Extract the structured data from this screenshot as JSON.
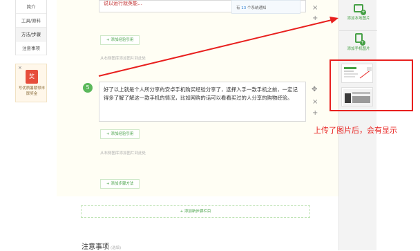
{
  "left_nav": {
    "items": [
      {
        "label": "简介",
        "active": false
      },
      {
        "label": "工具/原料",
        "active": false
      },
      {
        "label": "方法/步骤",
        "active": true
      },
      {
        "label": "注意事项",
        "active": false
      }
    ]
  },
  "promo": {
    "close": "×",
    "gift_icon": "gift-icon",
    "gift_char": "奖",
    "text": "写优质暑期领丰厚奖金"
  },
  "step4": {
    "text": "说以运行就英能…",
    "tooltip_prefix": "有",
    "tooltip_count": "13",
    "tooltip_suffix": "个系统通知",
    "cite_button": "+ 添加经验引用",
    "hint": "从右侧图库添加图片到此处"
  },
  "step5": {
    "number": "5",
    "text": "好了以上就是个人所分享的安卓手机购买经验分享了，选择入手一款手机之前，一定记得多了解了解这一款手机的情况，比如网购的话可以看看买过的人分享的购物经验。",
    "cite_button": "+ 添加经验引用",
    "hint": "从右侧图库添加图片到此处",
    "add_method_button": "+ 添加步骤方法"
  },
  "side_controls": {
    "close": "×",
    "add": "+",
    "move": "✥"
  },
  "add_new_step_section": "+ 添加新步骤栏目",
  "notes_section": {
    "title": "注意事项",
    "optional": "(选填)"
  },
  "right_panel": {
    "add_local_image": "添加本地图片",
    "add_mobile_image": "添加手机图片"
  },
  "annotation": "上传了图片后，会有显示",
  "colors": {
    "accent_green": "#45a045",
    "annotation_red": "#e8201e"
  }
}
